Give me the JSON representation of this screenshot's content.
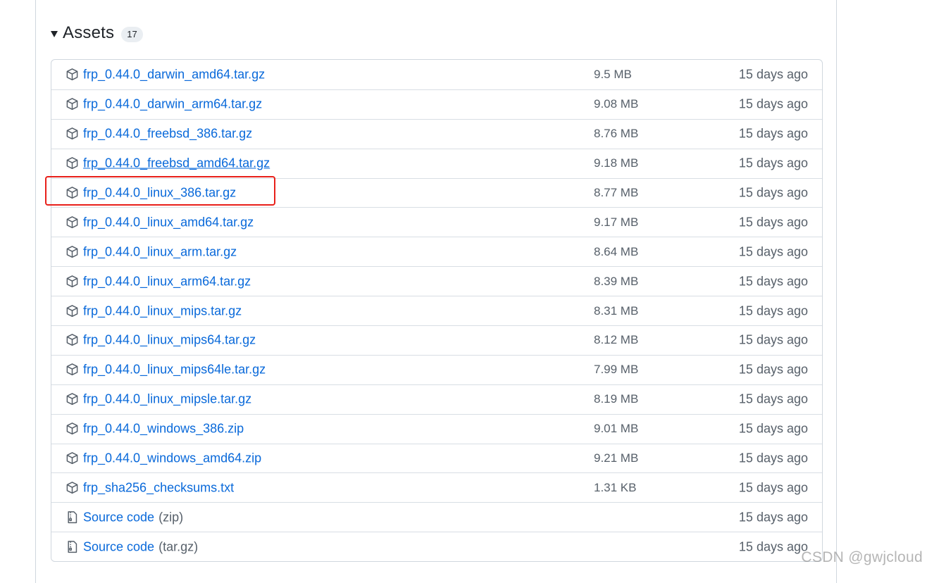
{
  "assets": {
    "title": "Assets",
    "count": "17",
    "items": [
      {
        "name": "frp_0.44.0_darwin_amd64.tar.gz",
        "size": "9.5 MB",
        "date": "15 days ago",
        "icon": "package-icon"
      },
      {
        "name": "frp_0.44.0_darwin_arm64.tar.gz",
        "size": "9.08 MB",
        "date": "15 days ago",
        "icon": "package-icon"
      },
      {
        "name": "frp_0.44.0_freebsd_386.tar.gz",
        "size": "8.76 MB",
        "date": "15 days ago",
        "icon": "package-icon"
      },
      {
        "name": "frp_0.44.0_freebsd_amd64.tar.gz",
        "size": "9.18 MB",
        "date": "15 days ago",
        "icon": "package-icon"
      },
      {
        "name": "frp_0.44.0_linux_386.tar.gz",
        "size": "8.77 MB",
        "date": "15 days ago",
        "icon": "package-icon"
      },
      {
        "name": "frp_0.44.0_linux_amd64.tar.gz",
        "size": "9.17 MB",
        "date": "15 days ago",
        "icon": "package-icon"
      },
      {
        "name": "frp_0.44.0_linux_arm.tar.gz",
        "size": "8.64 MB",
        "date": "15 days ago",
        "icon": "package-icon"
      },
      {
        "name": "frp_0.44.0_linux_arm64.tar.gz",
        "size": "8.39 MB",
        "date": "15 days ago",
        "icon": "package-icon"
      },
      {
        "name": "frp_0.44.0_linux_mips.tar.gz",
        "size": "8.31 MB",
        "date": "15 days ago",
        "icon": "package-icon"
      },
      {
        "name": "frp_0.44.0_linux_mips64.tar.gz",
        "size": "8.12 MB",
        "date": "15 days ago",
        "icon": "package-icon"
      },
      {
        "name": "frp_0.44.0_linux_mips64le.tar.gz",
        "size": "7.99 MB",
        "date": "15 days ago",
        "icon": "package-icon"
      },
      {
        "name": "frp_0.44.0_linux_mipsle.tar.gz",
        "size": "8.19 MB",
        "date": "15 days ago",
        "icon": "package-icon"
      },
      {
        "name": "frp_0.44.0_windows_386.zip",
        "size": "9.01 MB",
        "date": "15 days ago",
        "icon": "package-icon"
      },
      {
        "name": "frp_0.44.0_windows_amd64.zip",
        "size": "9.21 MB",
        "date": "15 days ago",
        "icon": "package-icon"
      },
      {
        "name": "frp_sha256_checksums.txt",
        "size": "1.31 KB",
        "date": "15 days ago",
        "icon": "package-icon"
      },
      {
        "name": "Source code",
        "suffix": "(zip)",
        "size": "",
        "date": "15 days ago",
        "icon": "file-zip-icon"
      },
      {
        "name": "Source code",
        "suffix": "(tar.gz)",
        "size": "",
        "date": "15 days ago",
        "icon": "file-zip-icon"
      }
    ]
  },
  "watermark": "CSDN @gwjcloud",
  "colors": {
    "link": "#0969da",
    "muted": "#57606a",
    "border": "#d0d7de",
    "highlight": "#e8201a"
  }
}
